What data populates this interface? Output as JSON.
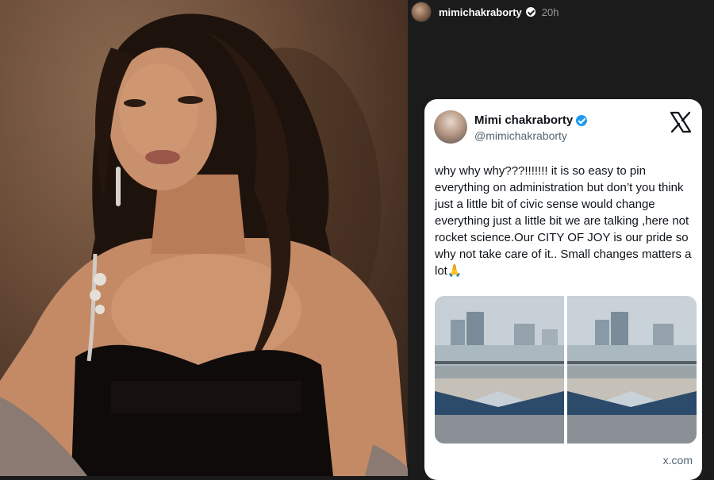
{
  "story": {
    "username": "mimichakraborty",
    "time": "20h"
  },
  "tweet": {
    "display_name": "Mimi chakraborty",
    "handle": "@mimichakraborty",
    "text": "why why why???!!!!!!! it is so easy to pin everything on administration but don’t you think just a little bit of civic sense would change everything just a little bit we are talking ,here not rocket science.Our CITY OF JOY is our pride so why not take care of it.. Small changes matters a lot🙏",
    "domain": "x.com"
  },
  "icons": {
    "x_logo": "x-logo-icon",
    "verified": "verified-badge-icon"
  },
  "colors": {
    "story_bg": "#1b1b1b",
    "verified_blue": "#1d9bf0",
    "card_bg": "#ffffff"
  }
}
